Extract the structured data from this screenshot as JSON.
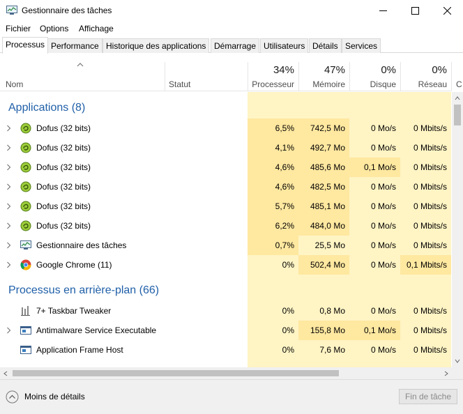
{
  "window": {
    "title": "Gestionnaire des tâches"
  },
  "menu": [
    "Fichier",
    "Options",
    "Affichage"
  ],
  "tabs": [
    "Processus",
    "Performance",
    "Historique des applications",
    "Démarrage",
    "Utilisateurs",
    "Détails",
    "Services"
  ],
  "active_tab": "Processus",
  "columns": {
    "name": "Nom",
    "status": "Statut",
    "cpu": {
      "label": "Processeur",
      "percent": "34%"
    },
    "memory": {
      "label": "Mémoire",
      "percent": "47%"
    },
    "disk": {
      "label": "Disque",
      "percent": "0%"
    },
    "network": {
      "label": "Réseau",
      "percent": "0%"
    },
    "overflow_label": "C"
  },
  "groups": [
    {
      "title": "Applications (8)",
      "rows": [
        {
          "name": "Dofus (32 bits)",
          "icon": "dofus-icon",
          "cpu": "6,5%",
          "memory": "742,5 Mo",
          "disk": "0 Mo/s",
          "network": "0 Mbits/s"
        },
        {
          "name": "Dofus (32 bits)",
          "icon": "dofus-icon",
          "cpu": "4,1%",
          "memory": "492,7 Mo",
          "disk": "0 Mo/s",
          "network": "0 Mbits/s"
        },
        {
          "name": "Dofus (32 bits)",
          "icon": "dofus-icon",
          "cpu": "4,6%",
          "memory": "485,6 Mo",
          "disk": "0,1 Mo/s",
          "network": "0 Mbits/s"
        },
        {
          "name": "Dofus (32 bits)",
          "icon": "dofus-icon",
          "cpu": "4,6%",
          "memory": "482,5 Mo",
          "disk": "0 Mo/s",
          "network": "0 Mbits/s"
        },
        {
          "name": "Dofus (32 bits)",
          "icon": "dofus-icon",
          "cpu": "5,7%",
          "memory": "485,1 Mo",
          "disk": "0 Mo/s",
          "network": "0 Mbits/s"
        },
        {
          "name": "Dofus (32 bits)",
          "icon": "dofus-icon",
          "cpu": "6,2%",
          "memory": "484,0 Mo",
          "disk": "0 Mo/s",
          "network": "0 Mbits/s"
        },
        {
          "name": "Gestionnaire des tâches",
          "icon": "task-manager-icon",
          "cpu": "0,7%",
          "memory": "25,5 Mo",
          "disk": "0 Mo/s",
          "network": "0 Mbits/s"
        },
        {
          "name": "Google Chrome (11)",
          "icon": "chrome-icon",
          "cpu": "0%",
          "memory": "502,4 Mo",
          "disk": "0 Mo/s",
          "network": "0,1 Mbits/s"
        }
      ]
    },
    {
      "title": "Processus en arrière-plan (66)",
      "rows": [
        {
          "name": "7+ Taskbar Tweaker",
          "icon": "taskbar-tweaker-icon",
          "cpu": "0%",
          "memory": "0,8 Mo",
          "disk": "0 Mo/s",
          "network": "0 Mbits/s"
        },
        {
          "name": "Antimalware Service Executable",
          "icon": "service-icon",
          "cpu": "0%",
          "memory": "155,8 Mo",
          "disk": "0,1 Mo/s",
          "network": "0 Mbits/s"
        },
        {
          "name": "Application Frame Host",
          "icon": "service-icon",
          "cpu": "0%",
          "memory": "7,6 Mo",
          "disk": "0 Mo/s",
          "network": "0 Mbits/s"
        }
      ]
    }
  ],
  "footer": {
    "less_details": "Moins de détails",
    "end_task": "Fin de tâche"
  },
  "colors": {
    "group_title": "#1f5fa8",
    "heat_low": "#fff4c4",
    "heat_mid": "#ffe8a0",
    "heat_high": "#ffd87a"
  }
}
